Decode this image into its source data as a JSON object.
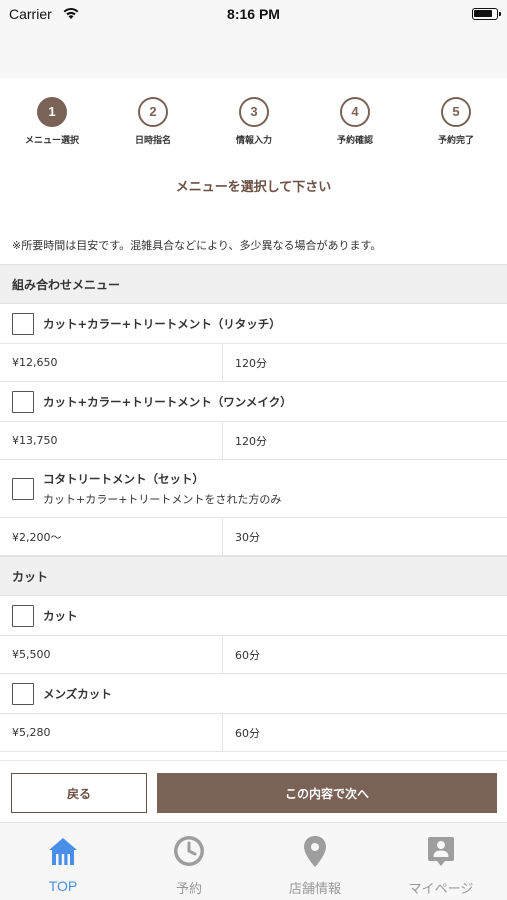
{
  "status_bar": {
    "carrier": "Carrier",
    "time": "8:16 PM"
  },
  "steps": [
    {
      "number": "1",
      "label": "メニュー選択"
    },
    {
      "number": "2",
      "label": "日時指名"
    },
    {
      "number": "3",
      "label": "情報入力"
    },
    {
      "number": "4",
      "label": "予約確認"
    },
    {
      "number": "5",
      "label": "予約完了"
    }
  ],
  "heading": "メニューを選択して下さい",
  "note": "※所要時間は目安です。混雑具合などにより、多少異なる場合があります。",
  "sections": [
    {
      "title": "組み合わせメニュー",
      "items": [
        {
          "name": "カット+カラー+トリートメント（リタッチ）",
          "price": "¥12,650",
          "duration": "120分"
        },
        {
          "name": "カット+カラー+トリートメント（ワンメイク）",
          "price": "¥13,750",
          "duration": "120分"
        },
        {
          "name": "コタトリートメント（セット）",
          "sub": "カット+カラー+トリートメントをされた方のみ",
          "price": "¥2,200〜",
          "duration": "30分"
        }
      ]
    },
    {
      "title": "カット",
      "items": [
        {
          "name": "カット",
          "price": "¥5,500",
          "duration": "60分"
        },
        {
          "name": "メンズカット",
          "price": "¥5,280",
          "duration": "60分"
        }
      ]
    }
  ],
  "buttons": {
    "back": "戻る",
    "next": "この内容で次へ"
  },
  "tabs": [
    {
      "label": "TOP",
      "icon": "home-icon"
    },
    {
      "label": "予約",
      "icon": "clock-icon"
    },
    {
      "label": "店舗情報",
      "icon": "map-pin-icon"
    },
    {
      "label": "マイページ",
      "icon": "profile-badge-icon"
    }
  ],
  "colors": {
    "brand_brown": "#7a6256",
    "tab_active": "#4a8fe7",
    "tab_inactive": "#999999"
  }
}
